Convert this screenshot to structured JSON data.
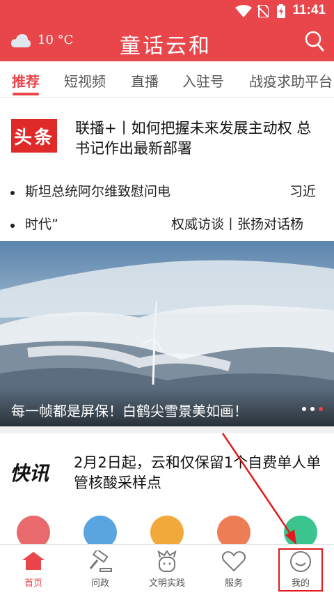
{
  "status_bar": {
    "time": "11:41"
  },
  "header": {
    "temperature": "10 °C",
    "brand": "童话云和"
  },
  "tabs": [
    {
      "label": "推荐",
      "active": true
    },
    {
      "label": "短视频"
    },
    {
      "label": "直播"
    },
    {
      "label": "入驻号"
    },
    {
      "label": "战疫求助平台"
    }
  ],
  "headline": {
    "logo": "头条",
    "text": "联播+丨如何把握未来发展主动权 总书记作出最新部署"
  },
  "bullets": [
    {
      "left": "斯坦总统阿尔维致慰问电",
      "right": "习近"
    },
    {
      "left": "时代”",
      "right": "权威访谈丨张扬对话杨"
    }
  ],
  "banner": {
    "caption": "每一帧都是屏保！白鹤尖雪景美如画！"
  },
  "news": {
    "logo": "快讯",
    "text": "2月2日起，云和仅保留1个自费单人单管核酸采样点"
  },
  "bottom_nav": [
    {
      "label": "首页",
      "icon": "home-icon",
      "active": true
    },
    {
      "label": "问政",
      "icon": "gavel-icon"
    },
    {
      "label": "文明实践",
      "icon": "mascot-icon"
    },
    {
      "label": "服务",
      "icon": "heart-icon"
    },
    {
      "label": "我的",
      "icon": "smile-icon"
    }
  ],
  "colors": {
    "brand_red": "#e8464a",
    "highlight_box": "#e3191c"
  }
}
